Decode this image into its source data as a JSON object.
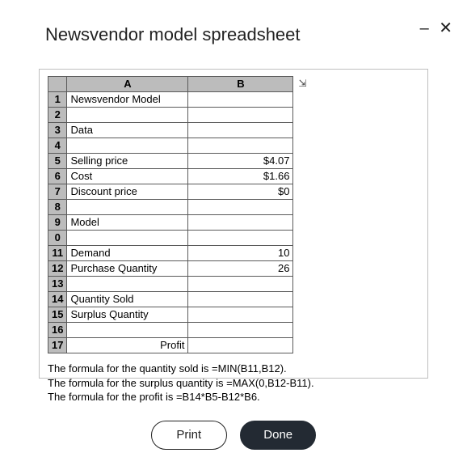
{
  "window": {
    "title": "Newsvendor model spreadsheet"
  },
  "sheet": {
    "col_headers": {
      "A": "A",
      "B": "B"
    },
    "rows": [
      {
        "n": "1",
        "a": "Newsvendor Model",
        "b": "",
        "a_align": "left"
      },
      {
        "n": "2",
        "a": "",
        "b": ""
      },
      {
        "n": "3",
        "a": "Data",
        "b": ""
      },
      {
        "n": "4",
        "a": "",
        "b": ""
      },
      {
        "n": "5",
        "a": "Selling price",
        "b": "$4.07"
      },
      {
        "n": "6",
        "a": "Cost",
        "b": "$1.66"
      },
      {
        "n": "7",
        "a": "Discount price",
        "b": "$0"
      },
      {
        "n": "8",
        "a": "",
        "b": ""
      },
      {
        "n": "9",
        "a": "Model",
        "b": ""
      },
      {
        "n": "0",
        "a": "",
        "b": ""
      },
      {
        "n": "11",
        "a": "Demand",
        "b": "10"
      },
      {
        "n": "12",
        "a": "Purchase Quantity",
        "b": "26"
      },
      {
        "n": "13",
        "a": "",
        "b": ""
      },
      {
        "n": "14",
        "a": "Quantity Sold",
        "b": ""
      },
      {
        "n": "15",
        "a": "Surplus Quantity",
        "b": ""
      },
      {
        "n": "16",
        "a": "",
        "b": ""
      },
      {
        "n": "17",
        "a": "Profit",
        "b": "",
        "a_align": "right"
      }
    ]
  },
  "notes": {
    "line1": "The formula for the quantity sold is =MIN(B11,B12).",
    "line2": "The formula for the surplus quantity is =MAX(0,B12-B11).",
    "line3": "The formula for the profit is =B14*B5-B12*B6."
  },
  "buttons": {
    "print": "Print",
    "done": "Done"
  }
}
